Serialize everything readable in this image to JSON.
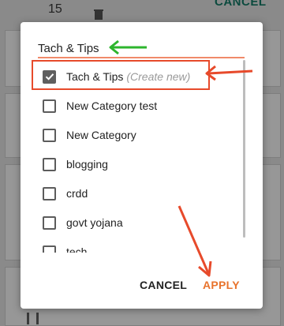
{
  "background": {
    "count": "15",
    "cancel_label": "CANCEL"
  },
  "dialog": {
    "search": {
      "value": "Tach & Tips",
      "placeholder": ""
    },
    "items": [
      {
        "label": "Tach & Tips",
        "suffix": "(Create new)",
        "checked": true
      },
      {
        "label": "New Category test",
        "checked": false
      },
      {
        "label": "New Category",
        "checked": false
      },
      {
        "label": "blogging",
        "checked": false
      },
      {
        "label": "crdd",
        "checked": false
      },
      {
        "label": "govt yojana",
        "checked": false
      },
      {
        "label": "tech",
        "checked": false
      }
    ],
    "cancel_label": "CANCEL",
    "apply_label": "APPLY"
  },
  "colors": {
    "accent": "#e8732c",
    "annotation_red": "#e74a2b",
    "annotation_green": "#2db52d"
  }
}
